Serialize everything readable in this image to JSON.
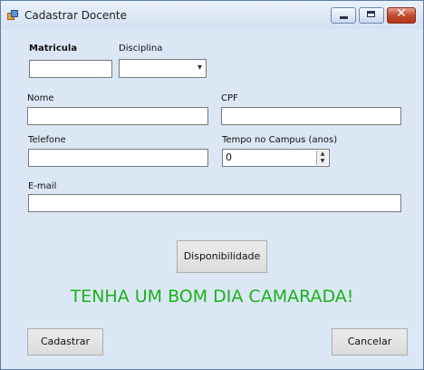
{
  "window": {
    "title": "Cadastrar Docente"
  },
  "fields": {
    "matricula_label": "Matricula",
    "disciplina_label": "Disciplina",
    "nome_label": "Nome",
    "cpf_label": "CPF",
    "telefone_label": "Telefone",
    "tempo_label": "Tempo no Campus (anos)",
    "tempo_value": "0",
    "email_label": "E-mail"
  },
  "buttons": {
    "disponibilidade": "Disponibilidade",
    "cadastrar": "Cadastrar",
    "cancelar": "Cancelar"
  },
  "message": "TENHA UM BOM DIA CAMARADA!",
  "colors": {
    "message": "#19b319",
    "background": "#dbe7f5"
  },
  "icons": [
    "app-icon",
    "minimize-icon",
    "maximize-icon",
    "close-icon",
    "chevron-down-icon",
    "spin-up-icon",
    "spin-down-icon"
  ]
}
